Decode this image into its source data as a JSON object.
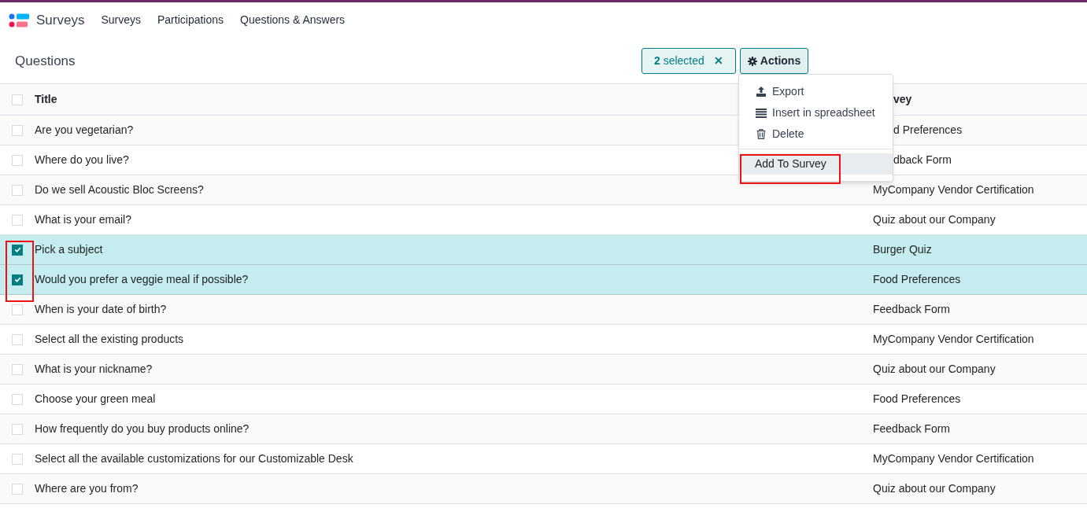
{
  "app": {
    "name": "Surveys"
  },
  "menu": [
    {
      "label": "Surveys"
    },
    {
      "label": "Participations"
    },
    {
      "label": "Questions & Answers"
    }
  ],
  "breadcrumb": "Questions",
  "selection": {
    "count": "2",
    "label": "selected",
    "clear": "✕"
  },
  "actions_button": {
    "label": "Actions",
    "expanded": true
  },
  "actions_menu": {
    "items": [
      {
        "label": "Export",
        "kind": "export"
      },
      {
        "label": "Insert in spreadsheet",
        "kind": "spreadsheet"
      },
      {
        "label": "Delete",
        "kind": "delete"
      }
    ],
    "extra": [
      {
        "label": "Add To Survey",
        "selected": true
      }
    ]
  },
  "table": {
    "all_checked": false,
    "columns": [
      {
        "label": "Title"
      },
      {
        "label": "vey",
        "covered": true
      }
    ],
    "rows": [
      {
        "title": "Are you vegetarian?",
        "survey": "d Preferences",
        "covered": true,
        "selected": false
      },
      {
        "title": "Where do you live?",
        "survey": "dback Form",
        "covered": true,
        "selected": false
      },
      {
        "title": "Do we sell Acoustic Bloc Screens?",
        "survey": "MyCompany Vendor Certification",
        "selected": false
      },
      {
        "title": "What is your email?",
        "survey": "Quiz about our Company",
        "selected": false
      },
      {
        "title": "Pick a subject",
        "survey": "Burger Quiz",
        "selected": true
      },
      {
        "title": "Would you prefer a veggie meal if possible?",
        "survey": "Food Preferences",
        "selected": true
      },
      {
        "title": "When is your date of birth?",
        "survey": "Feedback Form",
        "selected": false
      },
      {
        "title": "Select all the existing products",
        "survey": "MyCompany Vendor Certification",
        "selected": false
      },
      {
        "title": "What is your nickname?",
        "survey": "Quiz about our Company",
        "selected": false
      },
      {
        "title": "Choose your green meal",
        "survey": "Food Preferences",
        "selected": false
      },
      {
        "title": "How frequently do you buy products online?",
        "survey": "Feedback Form",
        "selected": false
      },
      {
        "title": "Select all the available customizations for our Customizable Desk",
        "survey": "MyCompany Vendor Certification",
        "selected": false
      },
      {
        "title": "Where are you from?",
        "survey": "Quiz about our Company",
        "selected": false
      }
    ]
  }
}
